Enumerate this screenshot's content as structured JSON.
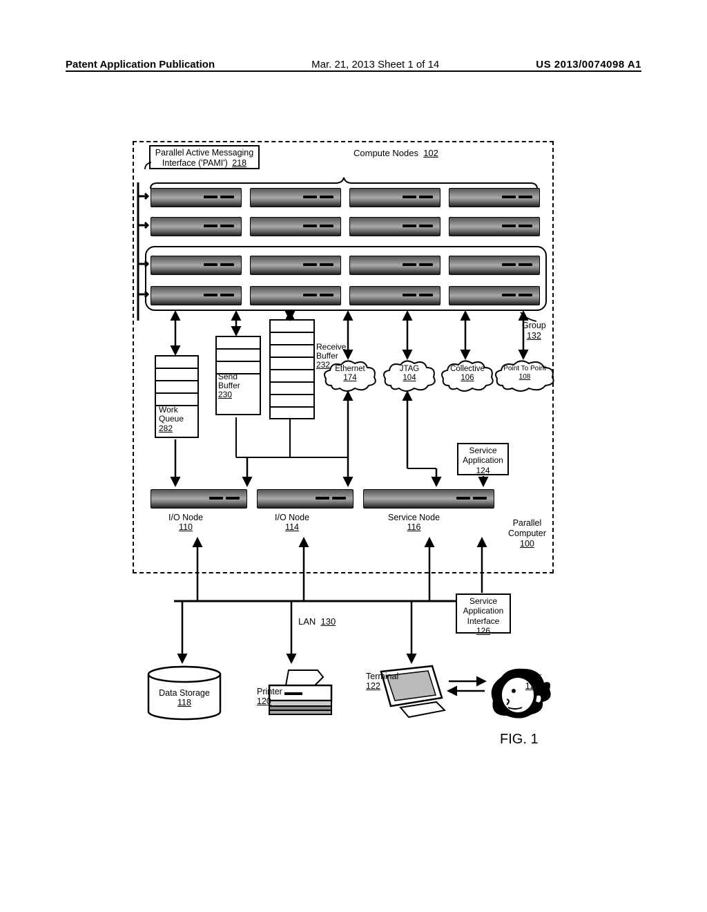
{
  "header": {
    "left": "Patent Application Publication",
    "center": "Mar. 21, 2013  Sheet 1 of 14",
    "right": "US 2013/0074098 A1"
  },
  "pami": {
    "line1": "Parallel Active Messaging",
    "line2": "Interface ('PAMI')",
    "ref": "218"
  },
  "compute_nodes": {
    "label": "Compute Nodes",
    "ref": "102"
  },
  "group": {
    "label": "Group",
    "ref": "132"
  },
  "work_queue": {
    "label": "Work\nQueue",
    "ref": "282"
  },
  "send_buffer": {
    "label": "Send\nBuffer",
    "ref": "230"
  },
  "receive_buffer": {
    "label": "Receive\nBuffer",
    "ref": "232"
  },
  "clouds": {
    "ethernet": {
      "label": "Ethernet",
      "ref": "174"
    },
    "jtag": {
      "label": "JTAG",
      "ref": "104"
    },
    "collective": {
      "label": "Collective",
      "ref": "106"
    },
    "p2p": {
      "label": "Point To Point",
      "ref": "108"
    }
  },
  "service_app": {
    "label": "Service\nApplication",
    "ref": "124"
  },
  "io_node_a": {
    "label": "I/O Node",
    "ref": "110"
  },
  "io_node_b": {
    "label": "I/O Node",
    "ref": "114"
  },
  "service_node": {
    "label": "Service Node",
    "ref": "116"
  },
  "parallel_computer": {
    "label": "Parallel\nComputer",
    "ref": "100"
  },
  "lan": {
    "label": "LAN",
    "ref": "130"
  },
  "service_app_if": {
    "label": "Service\nApplication\nInterface",
    "ref": "126"
  },
  "data_storage": {
    "label": "Data Storage",
    "ref": "118"
  },
  "printer": {
    "label": "Printer",
    "ref": "120"
  },
  "terminal": {
    "label": "Terminal",
    "ref": "122"
  },
  "user": {
    "label": "User",
    "ref": "128"
  },
  "figure": "FIG. 1"
}
